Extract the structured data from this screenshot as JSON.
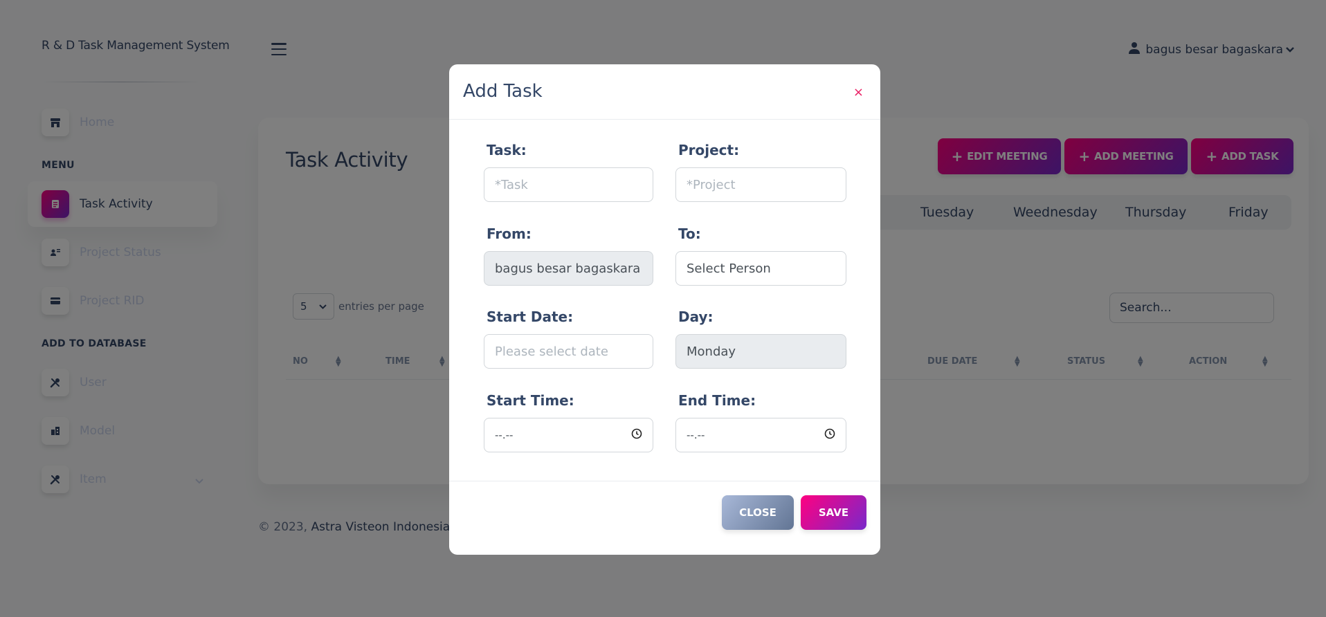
{
  "app": {
    "brand": "R & D Task Management System"
  },
  "sidebar": {
    "menu_section": "MENU",
    "db_section": "ADD TO DATABASE",
    "items": [
      {
        "label": "Home"
      },
      {
        "label": "Task Activity"
      },
      {
        "label": "Project Status"
      },
      {
        "label": "Project RID"
      },
      {
        "label": "User"
      },
      {
        "label": "Model"
      },
      {
        "label": "Item"
      }
    ]
  },
  "header": {
    "user_name": "bagus besar bagaskara"
  },
  "main": {
    "title": "Task Activity",
    "buttons": {
      "edit_meeting": "EDIT MEETING",
      "add_meeting": "ADD MEETING",
      "add_task": "ADD TASK"
    },
    "days": [
      "Tuesday",
      "Weednesday",
      "Thursday",
      "Friday"
    ],
    "entries": {
      "value": "5",
      "label": "entries per page"
    },
    "search_placeholder": "Search...",
    "columns": [
      "NO",
      "TIME",
      "DUE DATE",
      "STATUS",
      "ACTION"
    ]
  },
  "footer": {
    "prefix": "© 2023,",
    "company": "Astra Visteon Indonesia"
  },
  "modal": {
    "title": "Add Task",
    "close_glyph": "×",
    "task": {
      "label": "Task:",
      "placeholder": "*Task"
    },
    "project": {
      "label": "Project:",
      "placeholder": "*Project"
    },
    "from": {
      "label": "From:",
      "value": "bagus besar bagaskara"
    },
    "to": {
      "label": "To:",
      "value": "Select Person"
    },
    "start_date": {
      "label": "Start Date:",
      "placeholder": "Please select date"
    },
    "day": {
      "label": "Day:",
      "value": "Monday"
    },
    "start_time": {
      "label": "Start Time:",
      "value": "--.--"
    },
    "end_time": {
      "label": "End Time:",
      "value": "--.--"
    },
    "close_label": "CLOSE",
    "save_label": "SAVE"
  },
  "colors": {
    "accent_start": "#7928ca",
    "accent_end": "#ff0080",
    "text": "#344767"
  }
}
